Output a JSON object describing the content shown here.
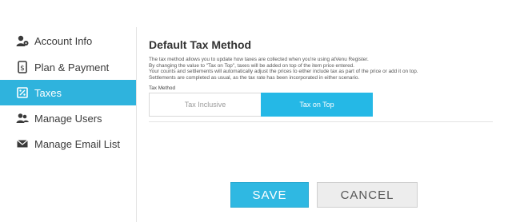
{
  "sidebar": {
    "items": [
      {
        "label": "Account Info",
        "icon": "account-info-icon"
      },
      {
        "label": "Plan & Payment",
        "icon": "plan-payment-icon"
      },
      {
        "label": "Taxes",
        "icon": "taxes-icon",
        "active": true
      },
      {
        "label": "Manage Users",
        "icon": "users-icon"
      },
      {
        "label": "Manage Email List",
        "icon": "envelope-icon"
      }
    ]
  },
  "main": {
    "title": "Default Tax Method",
    "description_lines": [
      "The tax method allows you to update how taxes are collected when you're using atVenu Register.",
      "By changing the value to \"Tax on Top\", taxes will be added on top of the item price entered.",
      "Your counts and settlements will automatically adjust the prices to either include tax as part of the price or add it on top.",
      "Settlements are completed as usual, as the tax rate has been incorporated in either scenario."
    ],
    "field_label": "Tax Method",
    "options": [
      {
        "label": "Tax Inclusive",
        "selected": false
      },
      {
        "label": "Tax on Top",
        "selected": true
      }
    ]
  },
  "actions": {
    "save_label": "SAVE",
    "cancel_label": "CANCEL"
  },
  "colors": {
    "accent": "#2fb3dd",
    "selected_option": "#25b8e6"
  }
}
